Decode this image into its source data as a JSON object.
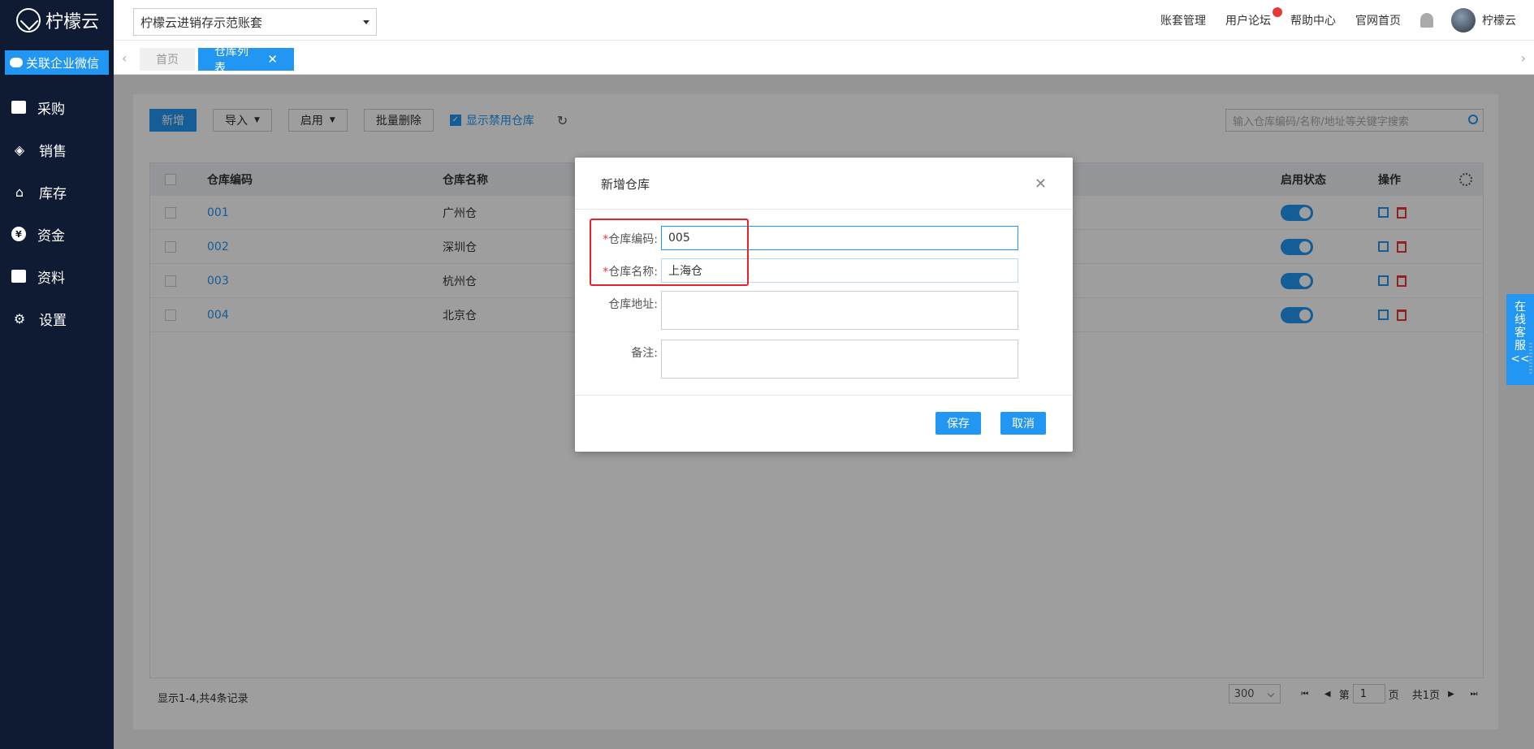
{
  "app": {
    "logo_text": "柠檬云",
    "wechat_button": "关联企业微信"
  },
  "sidebar": {
    "items": [
      {
        "label": "采购",
        "icon": "bag-icon"
      },
      {
        "label": "销售",
        "icon": "tag-icon"
      },
      {
        "label": "库存",
        "icon": "warehouse-icon"
      },
      {
        "label": "资金",
        "icon": "yen-icon"
      },
      {
        "label": "资料",
        "icon": "document-icon"
      },
      {
        "label": "设置",
        "icon": "gear-icon"
      }
    ]
  },
  "header": {
    "account": "柠檬云进销存示范账套",
    "links": [
      "账套管理",
      "用户论坛",
      "帮助中心",
      "官网首页"
    ],
    "user_name": "柠檬云"
  },
  "tabs": {
    "home": "首页",
    "active": "仓库列表"
  },
  "toolbar": {
    "add": "新增",
    "import": "导入",
    "enable": "启用",
    "batch_delete": "批量删除",
    "show_disabled": "显示禁用仓库",
    "search_placeholder": "输入仓库编码/名称/地址等关键字搜索"
  },
  "table": {
    "headers": {
      "code": "仓库编码",
      "name": "仓库名称",
      "status": "启用状态",
      "ops": "操作"
    },
    "rows": [
      {
        "code": "001",
        "name": "广州仓",
        "enabled": true
      },
      {
        "code": "002",
        "name": "深圳仓",
        "enabled": true
      },
      {
        "code": "003",
        "name": "杭州仓",
        "enabled": true
      },
      {
        "code": "004",
        "name": "北京仓",
        "enabled": true
      }
    ]
  },
  "footer": {
    "record_info": "显示1-4,共4条记录",
    "page_size": "300",
    "page_prefix": "第",
    "page_number": "1",
    "page_suffix": "页",
    "total_pages": "共1页"
  },
  "modal": {
    "title": "新增仓库",
    "fields": {
      "code_label": "仓库编码:",
      "code_value": "005",
      "name_label": "仓库名称:",
      "name_value": "上海仓",
      "address_label": "仓库地址:",
      "note_label": "备注:"
    },
    "save": "保存",
    "cancel": "取消"
  },
  "service": {
    "label_chars": [
      "在",
      "线",
      "客",
      "服",
      "<<"
    ]
  },
  "colors": {
    "sidebar_bg": "#0e1b33",
    "accent": "#2196f3",
    "highlight_box": "#e8222a"
  }
}
